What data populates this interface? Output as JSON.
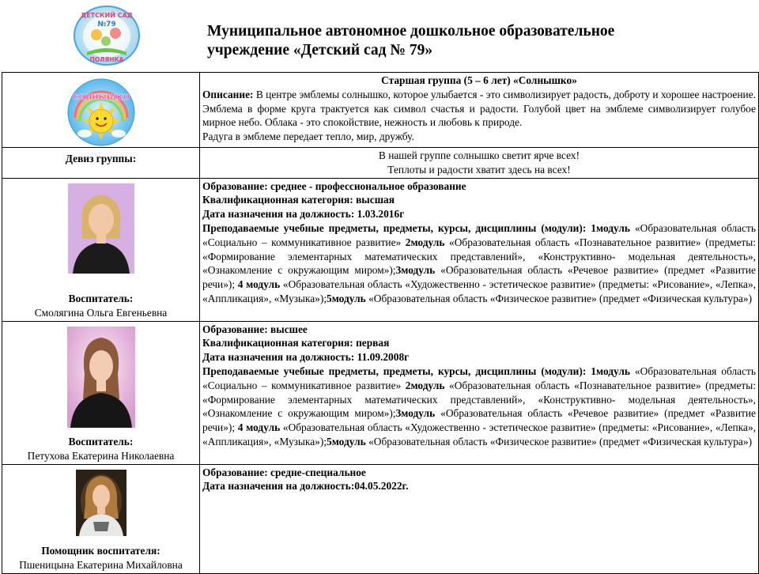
{
  "header": {
    "logo_text_top": "ДЕТСКИЙ САД",
    "logo_number": "№79",
    "logo_text_bottom": "ПОЛЯНКА",
    "title_line1": "Муниципальное автономное дошкольное образовательное",
    "title_line2": "учреждение «Детский сад № 79»"
  },
  "group": {
    "emblem_text": "СОЛНЫШКО",
    "title": "Старшая группа (5 – 6 лет) «Солнышко»",
    "description_label": "Описание:",
    "description_text": " В центре эмблемы солнышко, которое улыбается - это символизирует радость, доброту и хорошее настроение.  Эмблема в форме круга трактуется  как символ счастья и радости. Голубой цвет на эмблеме символизирует голубое мирное небо. Облака - это спокойствие, нежность и любовь к природе.",
    "description_text2": "Радуга в эмблеме передает тепло, мир, дружбу.",
    "motto_label": "Девиз группы:",
    "motto_line1": "В нашей группе солнышко светит ярче всех!",
    "motto_line2": "Теплоты и радости хватит здесь на всех!"
  },
  "teachers": [
    {
      "role": "Воспитатель:",
      "name": "Смолягина Ольга Евгеньевна",
      "education_label": "Образование:",
      "education_value": " среднее - профессиональное образование",
      "category_label": "Квалификационная категория:",
      "category_value": " высшая",
      "date_label": "Дата назначения на должность:",
      "date_value": " 1.03.2016г",
      "subjects_label": "Преподаваемые учебные предметы, предметы, курсы, дисциплины (модули):",
      "m1_label": " 1модуль",
      "m1_text": " «Образовательная область «Социально – коммуникативное развитие» ",
      "m2_label": "2модуль",
      "m2_text": " «Образовательная область «Познавательное развитие» (предметы: «Формирование элементарных математических представлений», «Конструктивно- модельная деятельность», «Ознакомление с окружающим миром»);",
      "m3_label": "3модуль",
      "m3_text": " «Образовательная область «Речевое развитие» (предмет «Развитие речи»); ",
      "m4_label": "4 модуль",
      "m4_text": " «Образовательная область «Художественно - эстетическое развитие» (предметы: «Рисование», «Лепка», «Аппликация», «Музыка»);",
      "m5_label": "5модуль",
      "m5_text": " «Образовательная область «Физическое развитие» (предмет «Физическая культура»)"
    },
    {
      "role": "Воспитатель:",
      "name": "Петухова Екатерина Николаевна",
      "education_label": "Образование:",
      "education_value": " высшее",
      "category_label": "Квалификационная категория:",
      "category_value": " первая",
      "date_label": "Дата назначения на должность:",
      "date_value": " 11.09.2008г",
      "subjects_label": "Преподаваемые учебные предметы, предметы, курсы, дисциплины (модули):",
      "m1_label": " 1модуль",
      "m1_text": " «Образовательная область «Социально – коммуникативное развитие» ",
      "m2_label": "2модуль",
      "m2_text": " «Образовательная область «Познавательное развитие» (предметы: «Формирование элементарных математических представлений», «Конструктивно- модельная деятельность», «Ознакомление с окружающим миром»);",
      "m3_label": "3модуль",
      "m3_text": " «Образовательная область «Речевое развитие» (предмет «Развитие речи»); ",
      "m4_label": "4 модуль",
      "m4_text": " «Образовательная область «Художественно - эстетическое развитие» (предметы: «Рисование», «Лепка», «Аппликация», «Музыка»);",
      "m5_label": "5модуль",
      "m5_text": " «Образовательная область «Физическое развитие» (предмет «Физическая культура»)"
    },
    {
      "role": "Помощник воспитателя:",
      "name": "Пшеницына Екатерина Михайловна",
      "education_label": "Образование:",
      "education_value": " средне-специальное",
      "date_label": "Дата назначения на должность:",
      "date_value": "04.05.2022г."
    }
  ]
}
